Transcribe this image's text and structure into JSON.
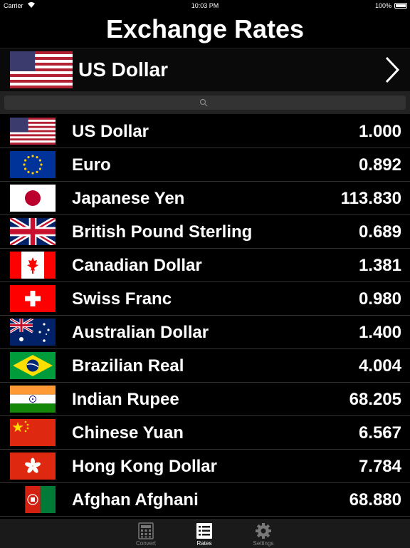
{
  "status_bar": {
    "carrier": "Carrier",
    "time": "10:03 PM",
    "battery": "100%"
  },
  "title": "Exchange Rates",
  "base_currency": {
    "name": "US Dollar",
    "flag": "us-flag-icon"
  },
  "search": {
    "placeholder": ""
  },
  "currencies": [
    {
      "name": "US Dollar",
      "rate": "1.000",
      "flag": "us-flag-icon"
    },
    {
      "name": "Euro",
      "rate": "0.892",
      "flag": "eu-flag-icon"
    },
    {
      "name": "Japanese Yen",
      "rate": "113.830",
      "flag": "jp-flag-icon"
    },
    {
      "name": "British Pound Sterling",
      "rate": "0.689",
      "flag": "gb-flag-icon"
    },
    {
      "name": "Canadian Dollar",
      "rate": "1.381",
      "flag": "ca-flag-icon"
    },
    {
      "name": "Swiss Franc",
      "rate": "0.980",
      "flag": "ch-flag-icon"
    },
    {
      "name": "Australian Dollar",
      "rate": "1.400",
      "flag": "au-flag-icon"
    },
    {
      "name": "Brazilian Real",
      "rate": "4.004",
      "flag": "br-flag-icon"
    },
    {
      "name": "Indian Rupee",
      "rate": "68.205",
      "flag": "in-flag-icon"
    },
    {
      "name": "Chinese Yuan",
      "rate": "6.567",
      "flag": "cn-flag-icon"
    },
    {
      "name": "Hong Kong Dollar",
      "rate": "7.784",
      "flag": "hk-flag-icon"
    },
    {
      "name": "Afghan Afghani",
      "rate": "68.880",
      "flag": "af-flag-icon"
    }
  ],
  "tabs": [
    {
      "label": "Convert",
      "icon": "calculator-icon",
      "active": false
    },
    {
      "label": "Rates",
      "icon": "list-icon",
      "active": true
    },
    {
      "label": "Settings",
      "icon": "gear-icon",
      "active": false
    }
  ]
}
